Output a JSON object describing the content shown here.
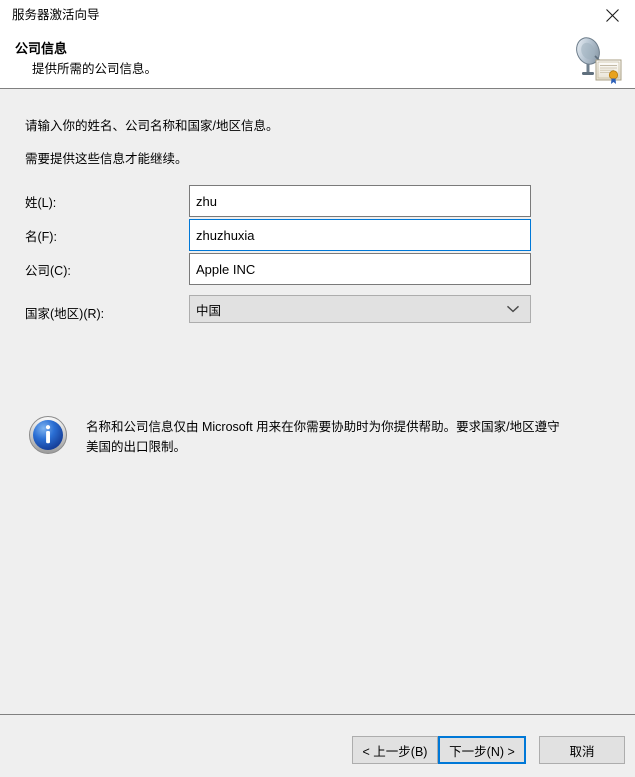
{
  "window": {
    "title": "服务器激活向导",
    "close_icon": "close-icon"
  },
  "header": {
    "title": "公司信息",
    "subtitle": "提供所需的公司信息。",
    "icon": "satellite-certificate-icon"
  },
  "body": {
    "intro_line_1": "请输入你的姓名、公司名称和国家/地区信息。",
    "intro_line_2": "需要提供这些信息才能继续。"
  },
  "form": {
    "fields": [
      {
        "label": "姓(L):",
        "value": "zhu",
        "placeholder": "",
        "focused": false
      },
      {
        "label": "名(F):",
        "value": "zhuzhuxia",
        "placeholder": "",
        "focused": true
      },
      {
        "label": "公司(C):",
        "value": "Apple INC",
        "placeholder": "",
        "focused": false
      }
    ],
    "country": {
      "label": "国家(地区)(R):",
      "value": "中国",
      "chevron_icon": "chevron-down-icon"
    }
  },
  "info": {
    "icon": "info-icon",
    "text": "名称和公司信息仅由 Microsoft 用来在你需要协助时为你提供帮助。要求国家/地区遵守美国的出口限制。"
  },
  "footer": {
    "back_label": "< 上一步(B)",
    "next_label": "下一步(N) >",
    "cancel_label": "取消"
  },
  "colors": {
    "accent": "#0078d7",
    "window_bg": "#efefef",
    "header_bg": "#ffffff",
    "field_bg": "#ffffff",
    "button_bg": "#e1e1e1",
    "border": "#7a7a7a",
    "separator": "#808080",
    "info_blue": "#1f5fd0"
  }
}
